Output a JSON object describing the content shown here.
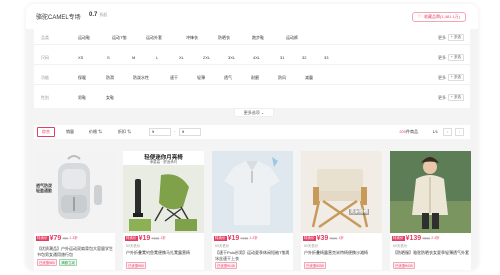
{
  "store": {
    "name": "骆驼CAMEL专场",
    "rating": "0.7",
    "rating_label": "折起",
    "collect_label": "收藏品牌(1,481.1万)"
  },
  "filters": [
    {
      "label": "品类",
      "options": [
        "运动鞋",
        "运动T恤",
        "运动外套",
        "冲锋衣",
        "防晒衣",
        "跑步鞋",
        "运动裤"
      ],
      "more": "更多",
      "multi": "多选"
    },
    {
      "label": "尺码",
      "options": [
        "XS",
        "S",
        "M",
        "L",
        "XL",
        "2XL",
        "3XL",
        "4XL",
        "31",
        "32",
        "33"
      ],
      "more": "更多",
      "multi": "多选"
    },
    {
      "label": "功能",
      "options": [
        "保暖",
        "防滑",
        "防泼水性",
        "速干",
        "轻薄",
        "透气",
        "耐磨",
        "防风",
        "减震"
      ],
      "more": "更多",
      "multi": "多选"
    },
    {
      "label": "性别",
      "options": [
        "男鞋",
        "女鞋"
      ],
      "more": "更多",
      "multi": "多选"
    }
  ],
  "expand_label": "更多选项 ⌄",
  "sortbar": {
    "items": [
      "综合",
      "销量",
      "价格 ⇅",
      "折扣 ⇅"
    ],
    "price_min": "¥",
    "price_max": "¥",
    "dash": "-",
    "count_num": "200",
    "count_suffix": "件商品",
    "page": "1/1",
    "prev": "‹",
    "next": "›"
  },
  "products": [
    {
      "badge": "特卖价",
      "price": "¥79",
      "orig": "¥59",
      "sub": "1.3折",
      "title": "【优质潮品】户外运动双肩背包大容量学生书包男女通用旅行包",
      "tags": [
        "已优惠¥80",
        "满额立减"
      ],
      "extra": ""
    },
    {
      "badge": "特卖价",
      "price": "¥19",
      "orig": "¥188",
      "sub": "1折",
      "title": "户外折叠凳钓鱼凳便携马扎凳露营椅",
      "tags": [
        "已优惠¥50"
      ],
      "extra": "60天低价"
    },
    {
      "badge": "特卖价",
      "price": "¥19",
      "orig": "¥165",
      "sub": "1.2折",
      "title": "【速干Polo衫男】运动夏季休闲短袖T恤男冰丝速干上衣",
      "tags": [
        "已优惠¥146"
      ],
      "extra": "60天低价"
    },
    {
      "badge": "特卖价",
      "price": "¥39",
      "orig": "¥398",
      "sub": "1折",
      "title": "户外折叠椅露营克米特椅便携沙滩椅",
      "tags": [
        "已优惠¥359"
      ],
      "extra": "60天低价"
    },
    {
      "badge": "特卖价",
      "price": "¥139",
      "orig": "¥569",
      "sub": "2.4折",
      "title": "【防晒服】骆驼防晒衣女夏季轻薄透气外套",
      "tags": [
        "已优惠¥430"
      ],
      "extra": "60天低价"
    }
  ],
  "product_overlays": {
    "p2_title": "轻便迷你月亮椅",
    "p2_sub": "承重高 · 舒适承托",
    "p4_text": "克米特椅",
    "p1_text": "透气防泼 轻盈通勤"
  }
}
